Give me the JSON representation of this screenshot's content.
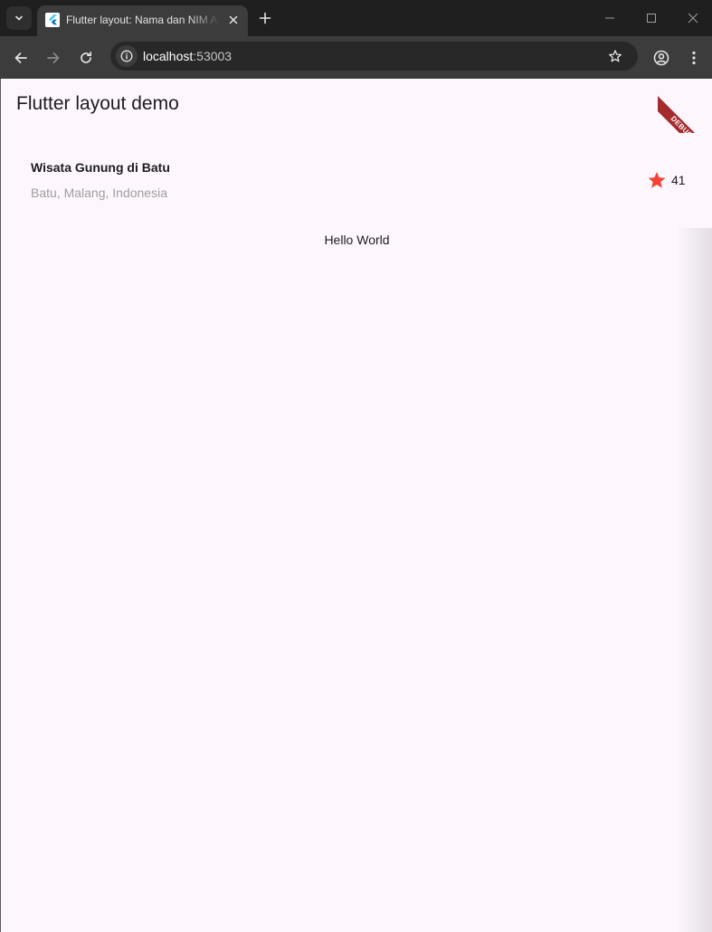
{
  "browser": {
    "tab": {
      "title": "Flutter layout: Nama dan NIM Anda",
      "favicon": "flutter-logo-icon"
    },
    "url": {
      "host": "localhost",
      "port": ":53003"
    },
    "icons": {
      "tab_search": "chevron-down-icon",
      "tab_close": "close-icon",
      "new_tab": "plus-icon",
      "minimize": "minimize-icon",
      "maximize": "maximize-icon",
      "window_close": "close-icon",
      "back": "arrow-left-icon",
      "forward": "arrow-right-icon",
      "reload": "reload-icon",
      "site_info": "info-icon",
      "bookmark": "star-outline-icon",
      "profile": "account-circle-icon",
      "menu": "kebab-menu-icon"
    }
  },
  "app": {
    "title": "Flutter layout demo",
    "debug_banner": "DEBUG",
    "place": {
      "name": "Wisata Gunung di Batu",
      "location": "Batu, Malang, Indonesia",
      "rating": "41",
      "rating_icon": "star-icon"
    },
    "body_text": "Hello World"
  },
  "colors": {
    "chrome_dark": "#1f1f1f",
    "toolbar": "#3c3c3c",
    "page_background": "#fdf7fd",
    "star": "#f44336",
    "secondary_text": "#9e9e9e",
    "debug_banner": "#a42b2e"
  }
}
